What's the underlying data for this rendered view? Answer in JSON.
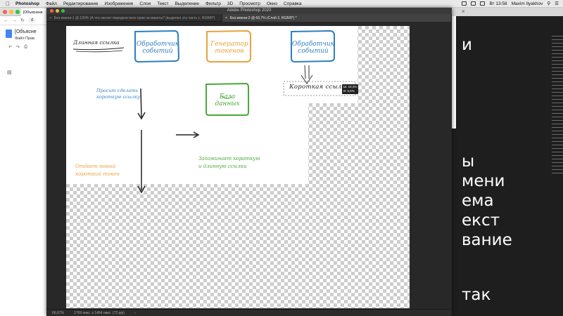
{
  "menubar": {
    "app": "Photoshop",
    "menus": [
      "Файл",
      "Редактирование",
      "Изображение",
      "Слои",
      "Текст",
      "Выделение",
      "Фильтр",
      "3D",
      "Просмотр",
      "Окно",
      "Справка"
    ],
    "clock": "Вт 13:58",
    "user": "Maxim Ilyakhov"
  },
  "browser": {
    "tab": "[Объяснени",
    "url": "d",
    "doc_title": "[Объясне",
    "doc_menu": "Файл  Прав"
  },
  "photoshop": {
    "window_title": "Adobe Photoshop 2020",
    "tab1": "Без имени-1 @ 100% (А что насчет передачи всех прав на макеты? (выделил эту часть с, RGB/8*)",
    "tab2": "Без имени-2 @ 66,7% (Слой 2, RGB/8*) *",
    "status_zoom": "66,67%",
    "status_info": "1769 пикс. x 1454 пикс. (72 ppi)"
  },
  "drawing": {
    "heading": "Длинная ссылка",
    "box1": [
      "Обработчик",
      "событий"
    ],
    "box2": [
      "Генератор",
      "токенов"
    ],
    "box3": [
      "Обработчик",
      "событий"
    ],
    "box4": [
      "База",
      "данных"
    ],
    "short_link": "Короткая ссылка",
    "note_request": [
      "Просит сделать",
      "короткую ссылку"
    ],
    "note_return": [
      "Отдает новый",
      "короткий токен"
    ],
    "note_store": [
      "Запоминает короткую",
      "и длинную ссылки"
    ],
    "readout": [
      "Ш: 18,3%",
      "В: 6,6%"
    ],
    "colors": {
      "blue": "#2f7fc1",
      "orange": "#e8a33a",
      "green": "#4aa83a",
      "ink": "#222222"
    }
  },
  "right_panel": {
    "lines": [
      "и",
      "ы",
      "мени",
      "ема",
      "екст",
      "вание",
      "так"
    ]
  }
}
